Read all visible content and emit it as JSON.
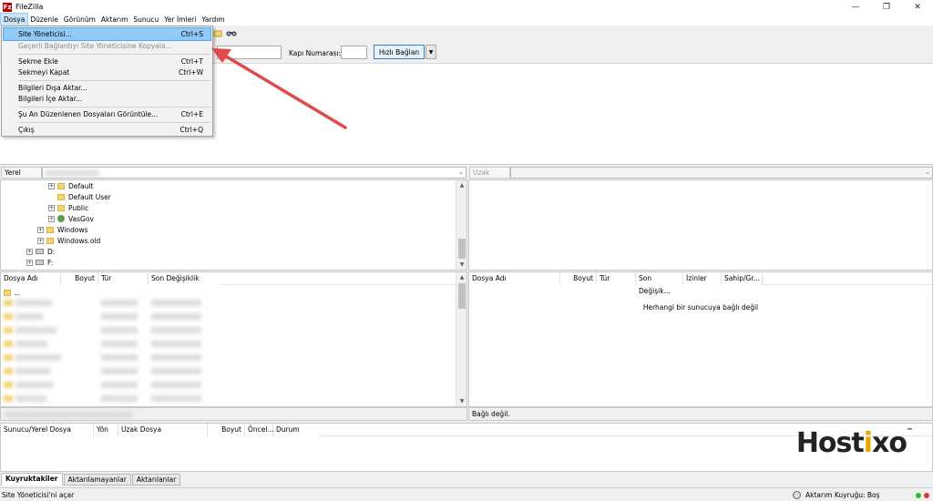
{
  "window": {
    "title": "FileZilla",
    "icon_letter": "Fz",
    "controls": [
      "—",
      "❐",
      "✕"
    ]
  },
  "menubar": [
    "Dosya",
    "Düzenle",
    "Görünüm",
    "Aktarım",
    "Sunucu",
    "Yer İmleri",
    "Yardım"
  ],
  "file_menu": [
    {
      "label": "Site Yöneticisi...",
      "shortcut": "Ctrl+S",
      "state": "highlighted"
    },
    {
      "label": "Geçerli Bağlantıyı Site Yöneticisine Kopyala...",
      "shortcut": "",
      "state": "disabled"
    },
    {
      "label": "Sekme Ekle",
      "shortcut": "Ctrl+T",
      "state": "normal"
    },
    {
      "label": "Sekmeyi Kapat",
      "shortcut": "Ctrl+W",
      "state": "normal"
    },
    {
      "label": "Bilgileri Dışa Aktar...",
      "shortcut": "",
      "state": "normal"
    },
    {
      "label": "Bilgileri İçe Aktar...",
      "shortcut": "",
      "state": "normal"
    },
    {
      "label": "Şu An Düzenlenen Dosyaları Görüntüle...",
      "shortcut": "Ctrl+E",
      "state": "normal"
    },
    {
      "label": "Çıkış",
      "shortcut": "Ctrl+Q",
      "state": "normal"
    }
  ],
  "quickconnect": {
    "port_label": "Kapı Numarası:",
    "port_value": "",
    "connect_label": "Hızlı Bağlan",
    "dropdown_glyph": "▼"
  },
  "local": {
    "site_label": "Yerel Site:",
    "tree": [
      {
        "label": "Default",
        "icon": "folder-icon"
      },
      {
        "label": "Default User",
        "icon": "folder-icon"
      },
      {
        "label": "Public",
        "icon": "folder-icon"
      },
      {
        "label": "VasGov",
        "icon": "user-folder-icon"
      },
      {
        "label": "Windows",
        "icon": "folder-icon"
      },
      {
        "label": "Windows.old",
        "icon": "folder-icon"
      },
      {
        "label": "D:",
        "icon": "drive-icon"
      },
      {
        "label": "F:",
        "icon": "drive-icon"
      }
    ],
    "columns": [
      "Dosya Adı",
      "Boyut",
      "Tür",
      "Son Değişiklik"
    ],
    "parent_dir": ".."
  },
  "remote": {
    "site_label": "Uzak Site:",
    "columns": [
      "Dosya Adı",
      "Boyut",
      "Tür",
      "Son Değişik...",
      "İzinler",
      "Sahip/Gr..."
    ],
    "empty_message": "Herhangi bir sunucuya bağlı değil",
    "status": "Bağlı değil."
  },
  "queue": {
    "columns": [
      "Sunucu/Yerel Dosya",
      "Yön",
      "Uzak Dosya",
      "Boyut",
      "Öncel...",
      "Durum"
    ],
    "logo_main": "Host",
    "logo_x": "i",
    "logo_tail": "xo",
    "logo_tm": "™"
  },
  "tabs": [
    "Kuyruktakiler",
    "Aktarılamayanlar",
    "Aktarılanlar"
  ],
  "status": {
    "left": "Site Yöneticisi'ni açar",
    "queue": "Aktarım Kuyruğu: Boş"
  },
  "colors": {
    "accent": "#e5f1fb",
    "highlight": "#91c9f7",
    "arrow": "#e04a4a",
    "logo_accent": "#e8a800",
    "led_green": "#2fbf3a",
    "led_red": "#d93a3a"
  }
}
